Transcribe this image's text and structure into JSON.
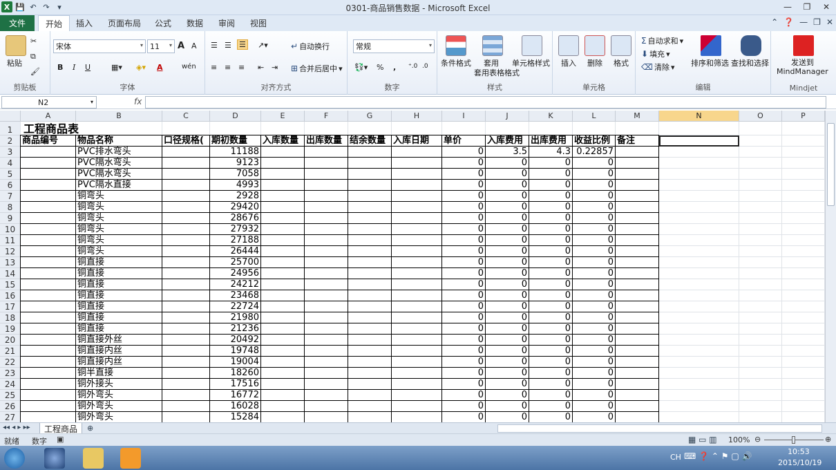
{
  "window": {
    "title": "0301-商品销售数据 - Microsoft Excel",
    "logo": "X"
  },
  "tabs": {
    "file": "文件",
    "items": [
      "开始",
      "插入",
      "页面布局",
      "公式",
      "数据",
      "审阅",
      "视图"
    ]
  },
  "ribbon": {
    "clipboard": {
      "label": "剪贴板",
      "paste": "粘贴"
    },
    "font": {
      "label": "字体",
      "name": "宋体",
      "size": "11",
      "bold": "B",
      "italic": "I",
      "underline": "U",
      "grow": "A",
      "shrink": "A",
      "color_a": "A",
      "phonetic": "wén"
    },
    "alignment": {
      "label": "对齐方式",
      "wrap": "自动换行",
      "merge": "合并后居中"
    },
    "number": {
      "label": "数字",
      "format": "常规",
      "percent": "%",
      "comma": ","
    },
    "styles": {
      "label": "样式",
      "conditional": "条件格式",
      "table_fmt": "套用表格格式",
      "cell_style": "单元格样式"
    },
    "cells": {
      "label": "单元格",
      "insert": "插入",
      "delete": "删除",
      "format": "格式"
    },
    "editing": {
      "label": "编辑",
      "autosum": "自动求和",
      "fill": "填充",
      "clear": "清除",
      "sort": "排序和筛选",
      "find": "查找和选择"
    },
    "mindjet": {
      "label": "Mindjet",
      "send": "发送到",
      "send2": "MindManager"
    }
  },
  "formula_bar": {
    "name_box": "N2",
    "fx": "fx",
    "value": ""
  },
  "columns": [
    "A",
    "B",
    "C",
    "D",
    "E",
    "F",
    "G",
    "H",
    "I",
    "J",
    "K",
    "L",
    "M",
    "N",
    "O",
    "P"
  ],
  "selected_column": "N",
  "sheet_title": "工程商品表",
  "headers": [
    "商品编号",
    "物品名称",
    "口径规格(",
    "期初数量",
    "入库数量",
    "出库数量",
    "结余数量",
    "入库日期",
    "单价",
    "入库费用",
    "出库费用",
    "收益比例",
    "备注"
  ],
  "rows": [
    {
      "r": "3",
      "name": "PVC排水弯头",
      "qty": "11188",
      "price": "0",
      "in_fee": "3.5",
      "out_fee": "4.3",
      "ratio": "0.22857"
    },
    {
      "r": "4",
      "name": "PVC隔水弯头",
      "qty": "9123",
      "price": "0",
      "in_fee": "0",
      "out_fee": "0",
      "ratio": "0"
    },
    {
      "r": "5",
      "name": "PVC隔水弯头",
      "qty": "7058",
      "price": "0",
      "in_fee": "0",
      "out_fee": "0",
      "ratio": "0"
    },
    {
      "r": "6",
      "name": "PVC隔水直接",
      "qty": "4993",
      "price": "0",
      "in_fee": "0",
      "out_fee": "0",
      "ratio": "0"
    },
    {
      "r": "7",
      "name": "铜弯头",
      "qty": "2928",
      "price": "0",
      "in_fee": "0",
      "out_fee": "0",
      "ratio": "0"
    },
    {
      "r": "8",
      "name": "铜弯头",
      "qty": "29420",
      "price": "0",
      "in_fee": "0",
      "out_fee": "0",
      "ratio": "0"
    },
    {
      "r": "9",
      "name": "铜弯头",
      "qty": "28676",
      "price": "0",
      "in_fee": "0",
      "out_fee": "0",
      "ratio": "0"
    },
    {
      "r": "10",
      "name": "铜弯头",
      "qty": "27932",
      "price": "0",
      "in_fee": "0",
      "out_fee": "0",
      "ratio": "0"
    },
    {
      "r": "11",
      "name": "铜弯头",
      "qty": "27188",
      "price": "0",
      "in_fee": "0",
      "out_fee": "0",
      "ratio": "0"
    },
    {
      "r": "12",
      "name": "铜弯头",
      "qty": "26444",
      "price": "0",
      "in_fee": "0",
      "out_fee": "0",
      "ratio": "0"
    },
    {
      "r": "13",
      "name": "铜直接",
      "qty": "25700",
      "price": "0",
      "in_fee": "0",
      "out_fee": "0",
      "ratio": "0"
    },
    {
      "r": "14",
      "name": "铜直接",
      "qty": "24956",
      "price": "0",
      "in_fee": "0",
      "out_fee": "0",
      "ratio": "0"
    },
    {
      "r": "15",
      "name": "铜直接",
      "qty": "24212",
      "price": "0",
      "in_fee": "0",
      "out_fee": "0",
      "ratio": "0"
    },
    {
      "r": "16",
      "name": "铜直接",
      "qty": "23468",
      "price": "0",
      "in_fee": "0",
      "out_fee": "0",
      "ratio": "0"
    },
    {
      "r": "17",
      "name": "铜直接",
      "qty": "22724",
      "price": "0",
      "in_fee": "0",
      "out_fee": "0",
      "ratio": "0"
    },
    {
      "r": "18",
      "name": "铜直接",
      "qty": "21980",
      "price": "0",
      "in_fee": "0",
      "out_fee": "0",
      "ratio": "0"
    },
    {
      "r": "19",
      "name": "铜直接",
      "qty": "21236",
      "price": "0",
      "in_fee": "0",
      "out_fee": "0",
      "ratio": "0"
    },
    {
      "r": "20",
      "name": "铜直接外丝",
      "qty": "20492",
      "price": "0",
      "in_fee": "0",
      "out_fee": "0",
      "ratio": "0"
    },
    {
      "r": "21",
      "name": "铜直接内丝",
      "qty": "19748",
      "price": "0",
      "in_fee": "0",
      "out_fee": "0",
      "ratio": "0"
    },
    {
      "r": "22",
      "name": "铜直接内丝",
      "qty": "19004",
      "price": "0",
      "in_fee": "0",
      "out_fee": "0",
      "ratio": "0"
    },
    {
      "r": "23",
      "name": "铜半直接",
      "qty": "18260",
      "price": "0",
      "in_fee": "0",
      "out_fee": "0",
      "ratio": "0"
    },
    {
      "r": "24",
      "name": "铜外接头",
      "qty": "17516",
      "price": "0",
      "in_fee": "0",
      "out_fee": "0",
      "ratio": "0"
    },
    {
      "r": "25",
      "name": "铜外弯头",
      "qty": "16772",
      "price": "0",
      "in_fee": "0",
      "out_fee": "0",
      "ratio": "0"
    },
    {
      "r": "26",
      "name": "铜外弯头",
      "qty": "16028",
      "price": "0",
      "in_fee": "0",
      "out_fee": "0",
      "ratio": "0"
    },
    {
      "r": "27",
      "name": "铜外弯头",
      "qty": "15284",
      "price": "0",
      "in_fee": "0",
      "out_fee": "0",
      "ratio": "0"
    }
  ],
  "sheet_tab": "工程商品",
  "status": {
    "ready": "就绪",
    "mode": "数字",
    "zoom": "100%"
  },
  "taskbar": {
    "lang": "CH",
    "time": "10:53",
    "date": "2015/10/19"
  },
  "colors": {
    "file_tab": "#1e7145",
    "selected_header": "#f8d68c"
  }
}
